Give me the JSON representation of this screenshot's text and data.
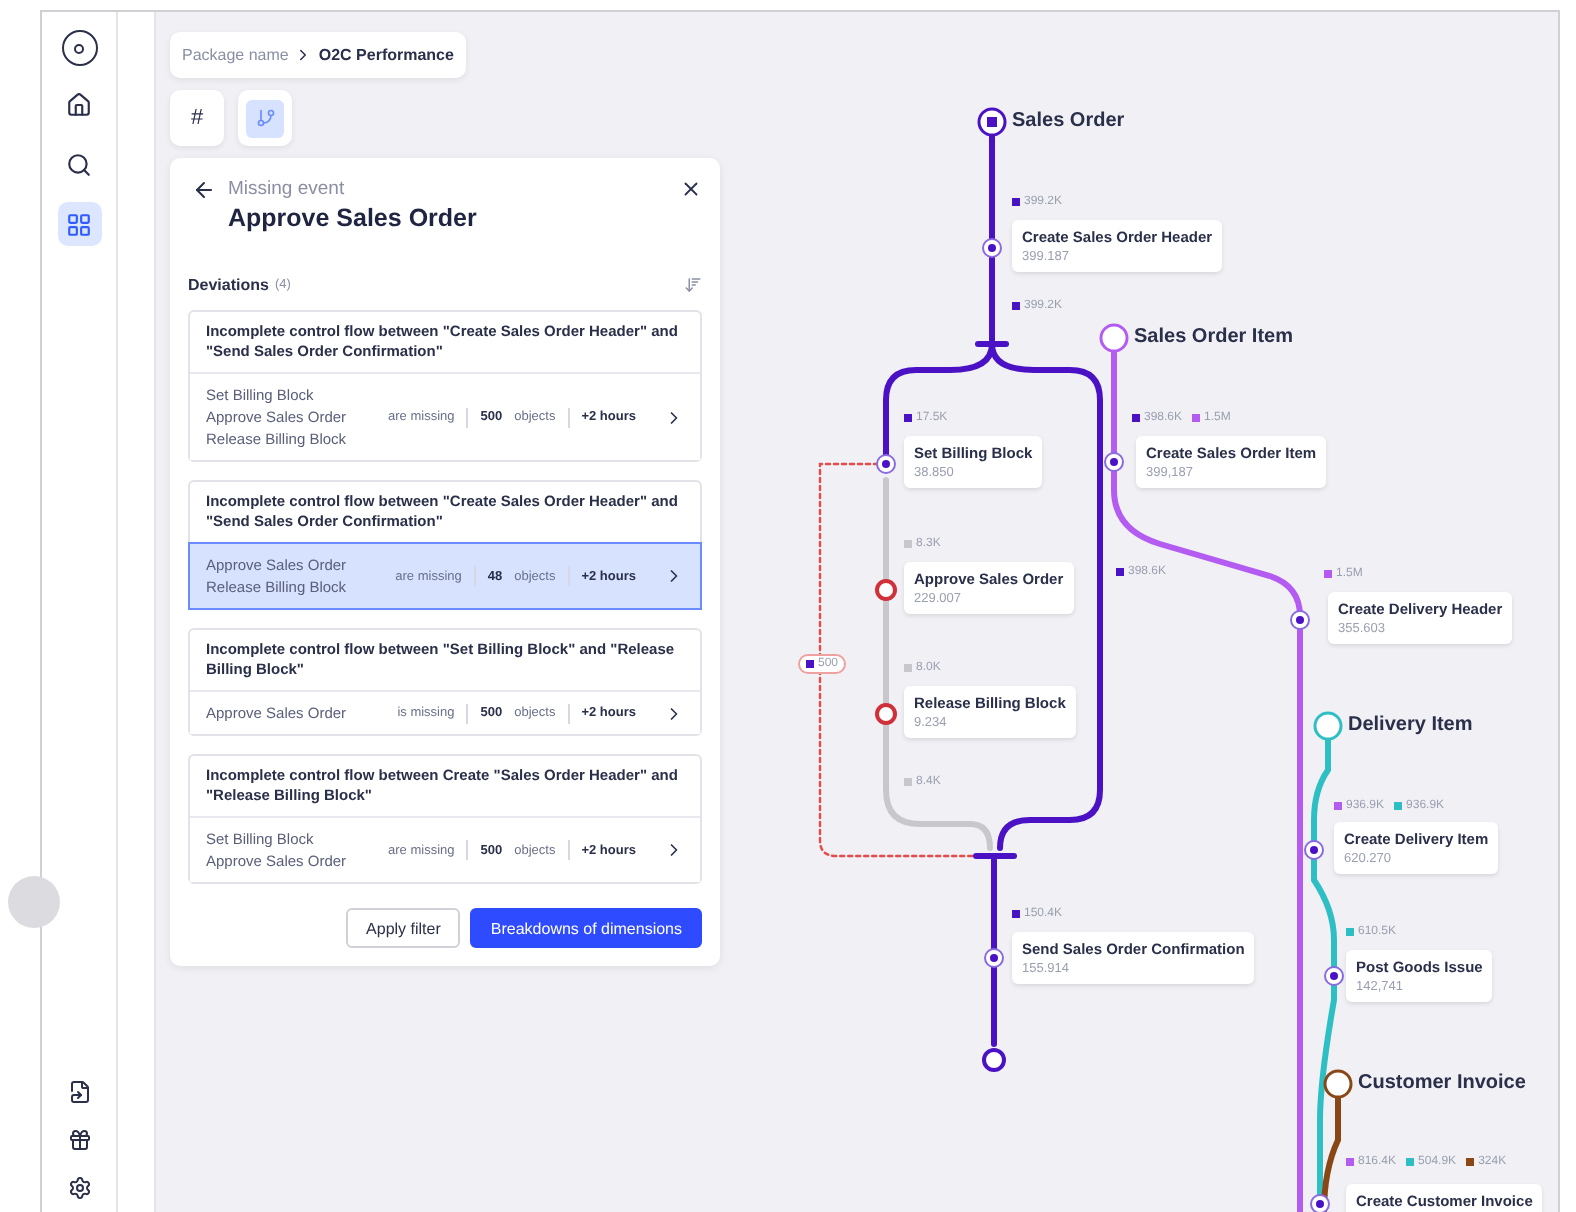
{
  "sidebar": {
    "nav_items": [
      {
        "selected": false
      },
      {
        "selected": false
      },
      {
        "selected": true
      }
    ]
  },
  "breadcrumb": {
    "items": [
      "Package name",
      "O2C Performance"
    ]
  },
  "view_toggle": [
    {
      "kind": "text",
      "label": "#",
      "selected": false
    },
    {
      "kind": "icon",
      "selected": true
    }
  ],
  "panel": {
    "subtitle": "Missing event",
    "title": "Approve Sales Order",
    "section": "Deviations",
    "count": "(4)",
    "deviations": [
      {
        "title": "Incomplete control flow between \"Create Sales Order Header\" and \"Send Sales Order Confirmation\"",
        "events": [
          "Set Billing Block",
          "Approve Sales Order",
          "Release Billing Block"
        ],
        "status": "are missing",
        "objects": "500",
        "objects_label": "objects",
        "duration": "+2 hours",
        "selected": false
      },
      {
        "title": "Incomplete control flow between \"Create Sales Order Header\" and \"Send Sales Order Confirmation\"",
        "events": [
          "Approve Sales Order",
          "Release Billing Block"
        ],
        "status": "are missing",
        "objects": "48",
        "objects_label": "objects",
        "duration": "+2 hours",
        "selected": true
      },
      {
        "title": "Incomplete control flow between \"Set Billing Block\" and \"Release Billing Block\"",
        "events": [
          "Approve Sales Order"
        ],
        "status": "is missing",
        "objects": "500",
        "objects_label": "objects",
        "duration": "+2 hours",
        "selected": false
      },
      {
        "title": "Incomplete control flow between Create \"Sales Order Header\" and \"Release Billing Block\"",
        "events": [
          "Set Billing Block",
          "Approve Sales Order"
        ],
        "status": "are missing",
        "objects": "500",
        "objects_label": "objects",
        "duration": "+2 hours",
        "selected": false
      }
    ],
    "buttons": [
      {
        "kind": "secondary",
        "label": "Apply filter"
      },
      {
        "kind": "primary",
        "label": "Breakdowns of dimensions"
      }
    ]
  },
  "graph": {
    "objects": [
      {
        "name": "Sales Order",
        "color": "#4a12c4"
      },
      {
        "name": "Sales Order Item",
        "color": "#b45cf2"
      },
      {
        "name": "Delivery Item",
        "color": "#2ebfc4"
      },
      {
        "name": "Customer Invoice",
        "color": "#8a4716"
      }
    ],
    "activities": [
      {
        "name": "Create Sales Order Header",
        "count": "399.187",
        "missing": false
      },
      {
        "name": "Set Billing Block",
        "count": "38.850",
        "missing": false
      },
      {
        "name": "Create Sales Order Item",
        "count": "399,187",
        "missing": false
      },
      {
        "name": "Approve Sales Order",
        "count": "229.007",
        "missing": true
      },
      {
        "name": "Create Delivery Header",
        "count": "355.603",
        "missing": false
      },
      {
        "name": "Release Billing Block",
        "count": "9.234",
        "missing": true
      },
      {
        "name": "Create Delivery Item",
        "count": "620.270",
        "missing": false
      },
      {
        "name": "Send Sales Order Confirmation",
        "count": "155.914",
        "missing": false
      },
      {
        "name": "Post Goods Issue",
        "count": "142,741",
        "missing": false
      },
      {
        "name": "Create Customer Invoice",
        "missing": false
      }
    ],
    "edge_labels": [
      {
        "kind": "plain",
        "values": [
          {
            "text": "399.2K",
            "color": "#4a12c4"
          }
        ]
      },
      {
        "kind": "plain",
        "values": [
          {
            "text": "399.2K",
            "color": "#4a12c4"
          }
        ]
      },
      {
        "kind": "plain",
        "values": [
          {
            "text": "17.5K",
            "color": "#4a12c4"
          }
        ]
      },
      {
        "kind": "plain",
        "values": [
          {
            "text": "398.6K",
            "color": "#4a12c4"
          },
          {
            "text": "1.5M",
            "color": "#b45cf2"
          }
        ]
      },
      {
        "kind": "plain",
        "values": [
          {
            "text": "8.3K",
            "color": "#c8c8cc"
          }
        ]
      },
      {
        "kind": "plain",
        "values": [
          {
            "text": "398.6K",
            "color": "#4a12c4"
          }
        ]
      },
      {
        "kind": "plain",
        "values": [
          {
            "text": "1.5M",
            "color": "#b45cf2"
          }
        ]
      },
      {
        "kind": "deviation",
        "values": [
          {
            "text": "500",
            "color": "#4a12c4"
          }
        ]
      },
      {
        "kind": "plain",
        "values": [
          {
            "text": "8.0K",
            "color": "#c8c8cc"
          }
        ]
      },
      {
        "kind": "plain",
        "values": [
          {
            "text": "8.4K",
            "color": "#c8c8cc"
          }
        ]
      },
      {
        "kind": "plain",
        "values": [
          {
            "text": "150.4K",
            "color": "#4a12c4"
          }
        ]
      },
      {
        "kind": "plain",
        "values": [
          {
            "text": "936.9K",
            "color": "#b45cf2"
          },
          {
            "text": "936.9K",
            "color": "#2ebfc4"
          }
        ]
      },
      {
        "kind": "plain",
        "values": [
          {
            "text": "610.5K",
            "color": "#2ebfc4"
          }
        ]
      },
      {
        "kind": "plain",
        "values": [
          {
            "text": "816.4K",
            "color": "#b45cf2"
          },
          {
            "text": "504.9K",
            "color": "#2ebfc4"
          },
          {
            "text": "324K",
            "color": "#8a4716"
          }
        ]
      }
    ]
  }
}
